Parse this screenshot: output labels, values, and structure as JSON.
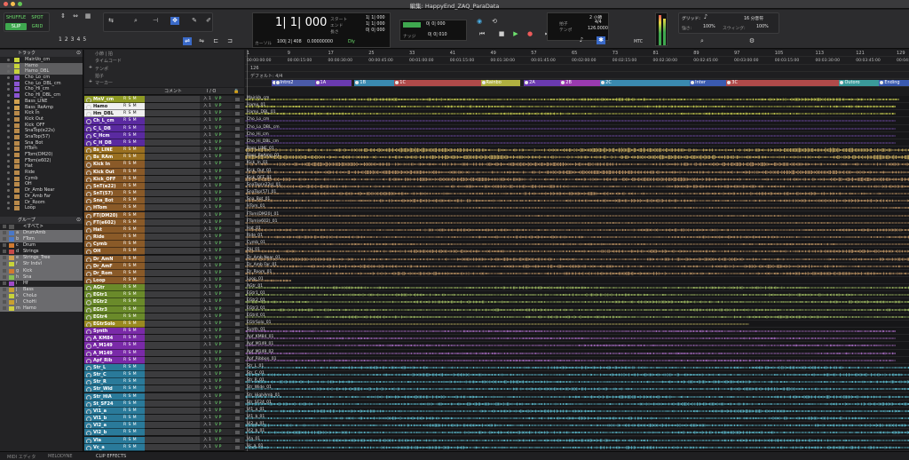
{
  "window": {
    "title": "編集: HappyEnd_ZAQ_ParaData"
  },
  "toolbar": {
    "modes": [
      "SHUFFLE",
      "SPOT",
      "SLIP",
      "GRID"
    ],
    "zoom_presets": [
      "1",
      "2",
      "3",
      "4",
      "5"
    ],
    "counter_main": "1| 1| 000",
    "counter_sub_label": "カーソル",
    "counter_sub_value": "100| 2| 408",
    "samples": "0.00000000",
    "dly_label": "Dly",
    "start_label": "スタート",
    "end_label": "エンド",
    "length_label": "長さ",
    "start_value": "1| 1| 000",
    "end_value": "1| 1| 000",
    "length_value": "0| 0| 000",
    "preroll_value": "0| 0| 000",
    "postroll_value": "0| 0| 000",
    "nudge_label": "ナッジ",
    "nudge_value": "0| 0| 010",
    "tempo_label": "テンポ",
    "tempo_value": "126.0000",
    "meter_label": "拍子",
    "meter_value": "4/4",
    "bars_value": "2 小節",
    "mtc_label": "MTC",
    "grid_label": "グリッド:",
    "grid_value": "16 分音符",
    "strength_label": "強さ:",
    "strength_value": "100%",
    "swing_label": "スウィング:",
    "swing_value": "100%"
  },
  "left": {
    "tracks_header": "トラック",
    "tracks": [
      {
        "name": "MainVo_cm",
        "color": "#c8d43a",
        "sel": false
      },
      {
        "name": "Hamo",
        "color": "#c8d43a",
        "sel": true
      },
      {
        "name": "Hamo_DBL",
        "color": "#c8d43a",
        "sel": true
      },
      {
        "name": "Cho_Lo_cm",
        "color": "#8a55d0",
        "sel": false
      },
      {
        "name": "Cho_Lo_DBL_cm",
        "color": "#8a55d0",
        "sel": false
      },
      {
        "name": "Cho_Hi_cm",
        "color": "#8a55d0",
        "sel": false
      },
      {
        "name": "Cho_Hi_DBL_cm",
        "color": "#8a55d0",
        "sel": false
      },
      {
        "name": "Bass_LINE",
        "color": "#d0a050",
        "sel": false
      },
      {
        "name": "Bass_ReAmp",
        "color": "#d0a050",
        "sel": false
      },
      {
        "name": "Kick In",
        "color": "#b8894a",
        "sel": false
      },
      {
        "name": "Kick Out",
        "color": "#b8894a",
        "sel": false
      },
      {
        "name": "Kick_OFF",
        "color": "#b8894a",
        "sel": false
      },
      {
        "name": "SnaTop(e22s)",
        "color": "#b8894a",
        "sel": false
      },
      {
        "name": "SnaTop(57)",
        "color": "#b8894a",
        "sel": false
      },
      {
        "name": "Sna_Bot",
        "color": "#b8894a",
        "sel": false
      },
      {
        "name": "HTom",
        "color": "#b8894a",
        "sel": false
      },
      {
        "name": "FTom(DM20)",
        "color": "#b8894a",
        "sel": false
      },
      {
        "name": "FTom(e602)",
        "color": "#b8894a",
        "sel": false
      },
      {
        "name": "Hat",
        "color": "#b8894a",
        "sel": false
      },
      {
        "name": "Ride",
        "color": "#b8894a",
        "sel": false
      },
      {
        "name": "Cymb",
        "color": "#b8894a",
        "sel": false
      },
      {
        "name": "OH",
        "color": "#b8894a",
        "sel": false
      },
      {
        "name": "Dr_Amb Near",
        "color": "#b8894a",
        "sel": false
      },
      {
        "name": "Dr_Amb Far",
        "color": "#b8894a",
        "sel": false
      },
      {
        "name": "Dr_Room",
        "color": "#b8894a",
        "sel": false
      },
      {
        "name": "Loop",
        "color": "#b8894a",
        "sel": false
      }
    ],
    "groups_header": "グループ",
    "groups": [
      {
        "letter": "",
        "name": "<すべて>",
        "color": "#555555",
        "sel": false
      },
      {
        "letter": "a",
        "name": "DrumAmb",
        "color": "#4a78c8",
        "sel": true
      },
      {
        "letter": "b",
        "name": "FTom",
        "color": "#4a78c8",
        "sel": true
      },
      {
        "letter": "c",
        "name": "Drum",
        "color": "#d07a30",
        "sel": false
      },
      {
        "letter": "d",
        "name": "Strings",
        "color": "#c84a4a",
        "sel": false
      },
      {
        "letter": "e",
        "name": "Strings_Tree",
        "color": "#d0a050",
        "sel": true
      },
      {
        "letter": "f",
        "name": "Str Indvl",
        "color": "#c8d43a",
        "sel": true
      },
      {
        "letter": "g",
        "name": "Kick",
        "color": "#d07a30",
        "sel": true
      },
      {
        "letter": "h",
        "name": "Sna",
        "color": "#8ac050",
        "sel": true
      },
      {
        "letter": "i",
        "name": "Hf",
        "color": "#a04ac8",
        "sel": false
      },
      {
        "letter": "j",
        "name": "Bass",
        "color": "#c8a030",
        "sel": true
      },
      {
        "letter": "k",
        "name": "ChoLo",
        "color": "#c8d43a",
        "sel": true
      },
      {
        "letter": "l",
        "name": "ChoHi",
        "color": "#c8a030",
        "sel": true
      },
      {
        "letter": "m",
        "name": "Hamo",
        "color": "#d0d040",
        "sel": true
      }
    ]
  },
  "rulers": {
    "bars_label": "小節 | 拍",
    "timecode_label": "タイムコード",
    "tempo_label": "テンポ",
    "meter_label": "拍子",
    "markers_label": "マーカー",
    "tempo_value": "126",
    "meter_value": "デフォルト: 4/4",
    "bar_numbers": [
      "1",
      "9",
      "17",
      "25",
      "33",
      "41",
      "49",
      "57",
      "65",
      "73",
      "81",
      "89",
      "97",
      "105",
      "113",
      "121",
      "129"
    ],
    "timecodes": [
      "00:00:00:00",
      "00:00:15:00",
      "00:00:30:00",
      "00:00:45:00",
      "00:01:00:00",
      "00:01:15:00",
      "00:01:30:00",
      "00:01:45:00",
      "00:02:00:00",
      "00:02:15:00",
      "00:02:30:00",
      "00:02:45:00",
      "00:03:00:00",
      "00:03:15:00",
      "00:03:30:00",
      "00:03:45:00",
      "00:04:00:00"
    ],
    "markers": [
      {
        "name": "Intro1",
        "color": "#4a4aa8",
        "at": 0.04,
        "w": 0.05
      },
      {
        "name": "Intro2",
        "color": "#4a5aa8",
        "at": 0.045,
        "w": 0.065
      },
      {
        "name": "1A",
        "color": "#6a3ab0",
        "at": 0.105,
        "w": 0.055
      },
      {
        "name": "1B",
        "color": "#3a8ab0",
        "at": 0.165,
        "w": 0.06
      },
      {
        "name": "1C",
        "color": "#b04a4a",
        "at": 0.225,
        "w": 0.13
      },
      {
        "name": "Rainbo",
        "color": "#b0b040",
        "at": 0.355,
        "w": 0.06
      },
      {
        "name": "2A",
        "color": "#6a3ab0",
        "at": 0.42,
        "w": 0.055
      },
      {
        "name": "2B",
        "color": "#9a3ab0",
        "at": 0.475,
        "w": 0.06
      },
      {
        "name": "2C",
        "color": "#3a8ab0",
        "at": 0.535,
        "w": 0.135
      },
      {
        "name": "Inter",
        "color": "#3a5ab0",
        "at": 0.67,
        "w": 0.055
      },
      {
        "name": "3C",
        "color": "#b04a4a",
        "at": 0.725,
        "w": 0.17
      },
      {
        "name": "Outoro",
        "color": "#3a9a9a",
        "at": 0.895,
        "w": 0.06
      },
      {
        "name": "Ending",
        "color": "#3a5ab0",
        "at": 0.955,
        "w": 0.045
      }
    ]
  },
  "columns": {
    "comment": "コメント",
    "io": "I / O"
  },
  "track_buttons": "R S M",
  "io_text": "入 1",
  "io_flag": "V P",
  "tracks": [
    {
      "name": "MnV_cm",
      "clip": "MainVo_cm",
      "color": "#e6ec5a",
      "nc": "#8e9a24",
      "start": 0.0,
      "end": 0.985,
      "dense": 0.55
    },
    {
      "name": "Hamo",
      "clip": "Hamo_01",
      "color": "#e6ec5a",
      "nc": "#8e9a24",
      "start": 0.0,
      "end": 0.98,
      "dense": 0.45,
      "sel": true
    },
    {
      "name": "Hm_DBL",
      "clip": "Hamo_DBL_01",
      "color": "#e6ec5a",
      "nc": "#8e9a24",
      "start": 0.0,
      "end": 0.98,
      "dense": 0.45,
      "sel": true
    },
    {
      "name": "Ch_L_cm",
      "clip": "Cho_Lo_cm",
      "color": "#8f5ed8",
      "nc": "#5a2aa0",
      "start": 0.0,
      "end": 0.98,
      "dense": 0.2
    },
    {
      "name": "C_L_DB",
      "clip": "Cho_Lo_DBL_cm",
      "color": "#8f5ed8",
      "nc": "#5a2aa0",
      "start": 0.0,
      "end": 0.98,
      "dense": 0.2
    },
    {
      "name": "C_Hcm",
      "clip": "Cho_Hi_cm",
      "color": "#8f5ed8",
      "nc": "#5a2aa0",
      "start": 0.0,
      "end": 0.98,
      "dense": 0.2
    },
    {
      "name": "C_H_DB",
      "clip": "Cho_Hi_DBL_cm",
      "color": "#8f5ed8",
      "nc": "#5a2aa0",
      "start": 0.0,
      "end": 0.98,
      "dense": 0.2
    },
    {
      "name": "Bs_LINE",
      "clip": "Bass_LINE_01",
      "color": "#e6c46a",
      "nc": "#9a7020",
      "start": 0.0,
      "end": 1.0,
      "dense": 0.85
    },
    {
      "name": "Bs_RAm",
      "clip": "Bass_ReAmp_01",
      "color": "#e6c46a",
      "nc": "#9a7020",
      "start": 0.0,
      "end": 1.0,
      "dense": 0.85
    },
    {
      "name": "Kick In",
      "clip": "Kick_In_01",
      "color": "#d8a870",
      "nc": "#8a5a28",
      "start": 0.0,
      "end": 1.0,
      "dense": 0.75
    },
    {
      "name": "Kick Out",
      "clip": "Kick_Out_01",
      "color": "#d8a870",
      "nc": "#8a5a28",
      "start": 0.0,
      "end": 1.0,
      "dense": 0.75
    },
    {
      "name": "Kick_OFF",
      "clip": "Kick_OFF_01",
      "color": "#d8a870",
      "nc": "#8a5a28",
      "start": 0.0,
      "end": 1.0,
      "dense": 0.75
    },
    {
      "name": "SnT(e22)",
      "clip": "SnaTop(e22s)_01",
      "color": "#d8a870",
      "nc": "#8a5a28",
      "start": 0.0,
      "end": 1.0,
      "dense": 0.6
    },
    {
      "name": "SnT(57)",
      "clip": "SnaTop(57)_01",
      "color": "#d8a870",
      "nc": "#8a5a28",
      "start": 0.0,
      "end": 1.0,
      "dense": 0.6
    },
    {
      "name": "Sna_Bot",
      "clip": "Sna_Bot_01",
      "color": "#d8a870",
      "nc": "#8a5a28",
      "start": 0.0,
      "end": 1.0,
      "dense": 0.6
    },
    {
      "name": "HTom",
      "clip": "HTom_01",
      "color": "#d8a870",
      "nc": "#8a5a28",
      "start": 0.0,
      "end": 1.0,
      "dense": 0.3
    },
    {
      "name": "FT(DM20)",
      "clip": "FTom(DM20)_01",
      "color": "#d8a870",
      "nc": "#8a5a28",
      "start": 0.0,
      "end": 1.0,
      "dense": 0.3
    },
    {
      "name": "FT(e602)",
      "clip": "FTom(e602)_01",
      "color": "#d8a870",
      "nc": "#8a5a28",
      "start": 0.0,
      "end": 1.0,
      "dense": 0.3
    },
    {
      "name": "Hat",
      "clip": "Hat_01",
      "color": "#d8a870",
      "nc": "#8a5a28",
      "start": 0.0,
      "end": 1.0,
      "dense": 0.5
    },
    {
      "name": "Ride",
      "clip": "Ride_01",
      "color": "#d8a870",
      "nc": "#8a5a28",
      "start": 0.0,
      "end": 1.0,
      "dense": 0.5
    },
    {
      "name": "Cymb",
      "clip": "Cymb_01",
      "color": "#d8a870",
      "nc": "#8a5a28",
      "start": 0.0,
      "end": 1.0,
      "dense": 0.4
    },
    {
      "name": "OH",
      "clip": "OH_01",
      "color": "#d8a870",
      "nc": "#8a5a28",
      "start": 0.0,
      "end": 1.0,
      "dense": 0.6
    },
    {
      "name": "Dr_AmN",
      "clip": "Dr_Amb Near_01",
      "color": "#d8a870",
      "nc": "#8a5a28",
      "start": 0.0,
      "end": 1.0,
      "dense": 0.6
    },
    {
      "name": "Dr_AmF",
      "clip": "Dr_Amb Far_01",
      "color": "#d8a870",
      "nc": "#8a5a28",
      "start": 0.0,
      "end": 1.0,
      "dense": 0.6
    },
    {
      "name": "Dr_Rom",
      "clip": "Dr_Room_01",
      "color": "#d8a870",
      "nc": "#8a5a28",
      "start": 0.0,
      "end": 1.0,
      "dense": 0.6
    },
    {
      "name": "Loop",
      "clip": "Loop_01",
      "color": "#d8a870",
      "nc": "#8a5a28",
      "start": 0.0,
      "end": 0.07,
      "dense": 0.4
    },
    {
      "name": "AGtr",
      "clip": "AGtr_01",
      "color": "#b8d870",
      "nc": "#6a8a2a",
      "start": 0.0,
      "end": 1.0,
      "dense": 0.5
    },
    {
      "name": "EGtr1",
      "clip": "EGtr1_01",
      "color": "#b8d870",
      "nc": "#6a8a2a",
      "start": 0.0,
      "end": 1.0,
      "dense": 0.5
    },
    {
      "name": "EGtr2",
      "clip": "EGtr2_01",
      "color": "#b8d870",
      "nc": "#6a8a2a",
      "start": 0.0,
      "end": 1.0,
      "dense": 0.5
    },
    {
      "name": "EGtr3",
      "clip": "EGtr3_01",
      "color": "#b8d870",
      "nc": "#6a8a2a",
      "start": 0.0,
      "end": 1.0,
      "dense": 0.5
    },
    {
      "name": "EGtr4",
      "clip": "EGtr4_01",
      "color": "#b8d870",
      "nc": "#6a8a2a",
      "start": 0.0,
      "end": 1.0,
      "dense": 0.5
    },
    {
      "name": "EGtrSolo",
      "clip": "EGtrSolo_01",
      "color": "#e6d870",
      "nc": "#9a8a20",
      "start": 0.0,
      "end": 0.76,
      "dense": 0.2
    },
    {
      "name": "Synth",
      "clip": "Synth_01",
      "color": "#c07ae0",
      "nc": "#7a2aa8",
      "start": 0.0,
      "end": 0.98,
      "dense": 0.4
    },
    {
      "name": "A_KM84",
      "clip": "Apf_KM84_01",
      "color": "#c07ae0",
      "nc": "#7a2aa8",
      "start": 0.0,
      "end": 0.98,
      "dense": 0.4
    },
    {
      "name": "A_M149",
      "clip": "Apf_M149_01",
      "color": "#c07ae0",
      "nc": "#7a2aa8",
      "start": 0.0,
      "end": 0.98,
      "dense": 0.4
    },
    {
      "name": "A_M149",
      "clip": "Apf_M149_02",
      "color": "#c07ae0",
      "nc": "#7a2aa8",
      "start": 0.0,
      "end": 0.98,
      "dense": 0.4
    },
    {
      "name": "Apf_Rib",
      "clip": "Apf_Ribbon_01",
      "color": "#c07ae0",
      "nc": "#7a2aa8",
      "start": 0.0,
      "end": 0.98,
      "dense": 0.4
    },
    {
      "name": "Str_L",
      "clip": "Str_L_01",
      "color": "#6ad8ee",
      "nc": "#2a7a9a",
      "start": 0.0,
      "end": 1.0,
      "dense": 0.55
    },
    {
      "name": "Str_C",
      "clip": "Str_C_01",
      "color": "#6ad8ee",
      "nc": "#2a7a9a",
      "start": 0.0,
      "end": 1.0,
      "dense": 0.55
    },
    {
      "name": "Str_R",
      "clip": "Str_R_01",
      "color": "#6ad8ee",
      "nc": "#2a7a9a",
      "start": 0.0,
      "end": 1.0,
      "dense": 0.55
    },
    {
      "name": "Str_Wid",
      "clip": "Str_Wide_01",
      "color": "#6ad8ee",
      "nc": "#2a7a9a",
      "start": 0.0,
      "end": 1.0,
      "dense": 0.55
    },
    {
      "name": "Str_HiA",
      "clip": "Str_HighAmb_01",
      "color": "#6ad8ee",
      "nc": "#2a7a9a",
      "start": 0.0,
      "end": 1.0,
      "dense": 0.55
    },
    {
      "name": "St_SF24",
      "clip": "Str_SF24_01",
      "color": "#6ad8ee",
      "nc": "#2a7a9a",
      "start": 0.0,
      "end": 1.0,
      "dense": 0.55
    },
    {
      "name": "Vl1_a",
      "clip": "Vl1_a_01",
      "color": "#6ad8ee",
      "nc": "#2a7a9a",
      "start": 0.0,
      "end": 1.0,
      "dense": 0.55
    },
    {
      "name": "Vl1_b",
      "clip": "Vl1_b_01",
      "color": "#6ad8ee",
      "nc": "#2a7a9a",
      "start": 0.0,
      "end": 1.0,
      "dense": 0.55
    },
    {
      "name": "Vl2_a",
      "clip": "Vl2_a_01",
      "color": "#6ad8ee",
      "nc": "#2a7a9a",
      "start": 0.0,
      "end": 1.0,
      "dense": 0.55
    },
    {
      "name": "Vl2_b",
      "clip": "Vl2_b_01",
      "color": "#6ad8ee",
      "nc": "#2a7a9a",
      "start": 0.0,
      "end": 1.0,
      "dense": 0.55
    },
    {
      "name": "Vla",
      "clip": "Vla_01",
      "color": "#6ad8ee",
      "nc": "#2a7a9a",
      "start": 0.0,
      "end": 1.0,
      "dense": 0.55
    },
    {
      "name": "Vc_a",
      "clip": "Vc_a_01",
      "color": "#6ad8ee",
      "nc": "#2a7a9a",
      "start": 0.0,
      "end": 1.0,
      "dense": 0.55
    }
  ],
  "bottom": {
    "tabs": [
      "MIDI エディタ",
      "MELODYNE",
      "CLIP EFFECTS"
    ]
  }
}
